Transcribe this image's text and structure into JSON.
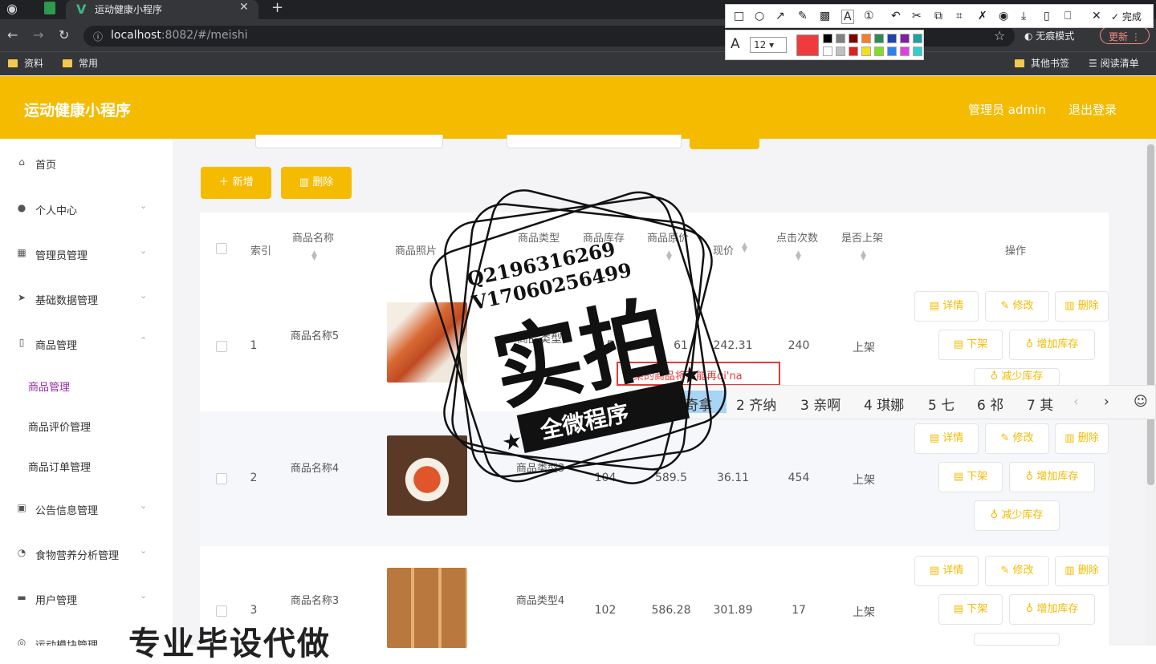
{
  "browser": {
    "tab_title": "运动健康小程序",
    "url_host": "localhost",
    "url_rest": ":8082/#/meishi",
    "incognito_label": "无痕模式",
    "update_label": "更新",
    "bookmarks": [
      "资料",
      "常用"
    ],
    "other_bookmarks": "其他书签",
    "reading_list": "阅读清单"
  },
  "app": {
    "title": "运动健康小程序",
    "admin_label": "管理员 admin",
    "logout_label": "退出登录",
    "accent": "#f5bb00"
  },
  "sidebar": {
    "items": [
      {
        "label": "首页",
        "icon": "home-icon"
      },
      {
        "label": "个人中心",
        "icon": "user-icon"
      },
      {
        "label": "管理员管理",
        "icon": "grid-icon"
      },
      {
        "label": "基础数据管理",
        "icon": "send-icon"
      },
      {
        "label": "商品管理",
        "icon": "phone-icon"
      },
      {
        "label": "公告信息管理",
        "icon": "briefcase-icon"
      },
      {
        "label": "食物营养分析管理",
        "icon": "gauge-icon"
      },
      {
        "label": "用户管理",
        "icon": "chat-icon"
      },
      {
        "label": "运动模块管理",
        "icon": "sport-icon"
      }
    ],
    "subitems": [
      "商品管理",
      "商品评价管理",
      "商品订单管理"
    ]
  },
  "actions": {
    "add_label": "新增",
    "delete_label": "删除"
  },
  "table": {
    "headers": [
      "索引",
      "商品名称",
      "商品照片",
      "商品类型",
      "商品库存",
      "商品原价",
      "现价",
      "点击次数",
      "是否上架",
      "操作"
    ],
    "rows": [
      {
        "index": "1",
        "name": "商品名称5",
        "type": "商品类型",
        "stock": "5",
        "orig": "61",
        "price": "242.31",
        "clicks": "240",
        "status": "上架"
      },
      {
        "index": "2",
        "name": "商品名称4",
        "type": "商品类型3",
        "stock": "104",
        "orig": "589.5",
        "price": "36.11",
        "clicks": "454",
        "status": "上架"
      },
      {
        "index": "3",
        "name": "商品名称3",
        "type": "商品类型4",
        "stock": "102",
        "orig": "586.28",
        "price": "301.89",
        "clicks": "17",
        "status": "上架"
      }
    ],
    "row_actions": {
      "detail": "详情",
      "edit": "修改",
      "delete": "删除",
      "off_shelf": "下架",
      "add_stock": "增加库存",
      "reduce_stock": "减少库存"
    }
  },
  "ime": {
    "compose": "下架的商品将不能再qi'na",
    "candidates": [
      "1 奇拿",
      "2 齐纳",
      "3 亲啊",
      "4 琪娜",
      "5 七",
      "6 祁",
      "7 其"
    ]
  },
  "screenshot_tool": {
    "done_label": "完成",
    "font_size": "12"
  },
  "stamp": {
    "contact_q": "Q2196316269",
    "contact_v": "V17060256499",
    "main": "实拍",
    "banner": "全微程序"
  },
  "watermark": "专业毕设代做"
}
